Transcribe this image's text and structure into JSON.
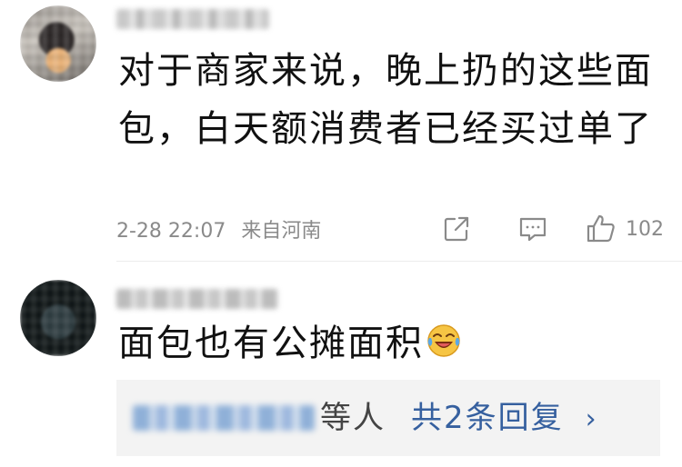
{
  "comments": [
    {
      "text": "对于商家来说，晚上扔的这些面包，白天额消费者已经买过单了",
      "date": "2-28 22:07",
      "location": "来自河南",
      "likes": "102"
    },
    {
      "text": "面包也有公摊面积",
      "emoji": "laughing-crying-emoji",
      "replies": {
        "suffix": "等人",
        "count_label": "共2条回复",
        "chevron": "›"
      }
    }
  ],
  "icons": {
    "share": "share-icon",
    "reply": "comment-icon",
    "like": "thumbs-up-icon"
  },
  "colors": {
    "link": "#36609f",
    "meta": "#8a8a8a",
    "reply_box": "#f3f3f3"
  }
}
